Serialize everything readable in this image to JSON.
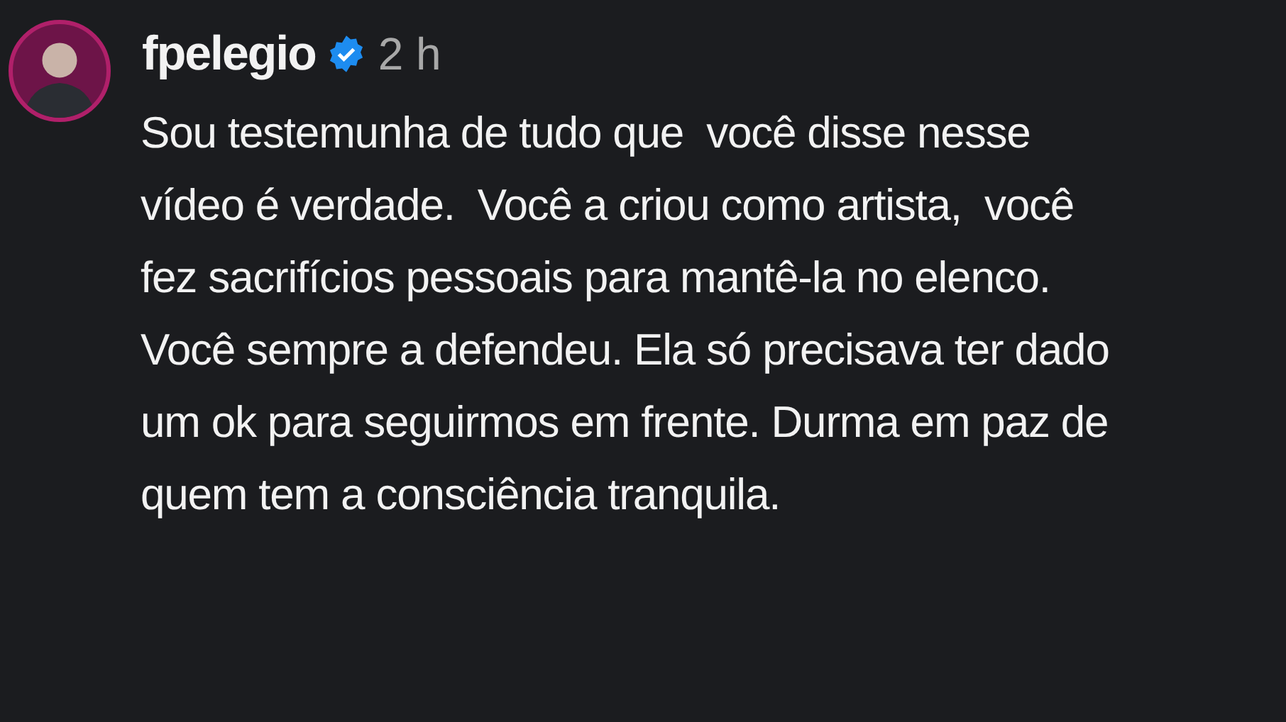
{
  "comment": {
    "username": "fpelegio",
    "verified": true,
    "time": "2 h",
    "text": "Sou testemunha de tudo que  você disse nesse\nvídeo é verdade.  Você a criou como artista,  você\nfez sacrifícios pessoais para mantê-la no elenco.\nVocê sempre a defendeu. Ela só precisava ter dado\num ok para seguirmos em frente. Durma em paz de\nquem tem a consciência tranquila."
  }
}
